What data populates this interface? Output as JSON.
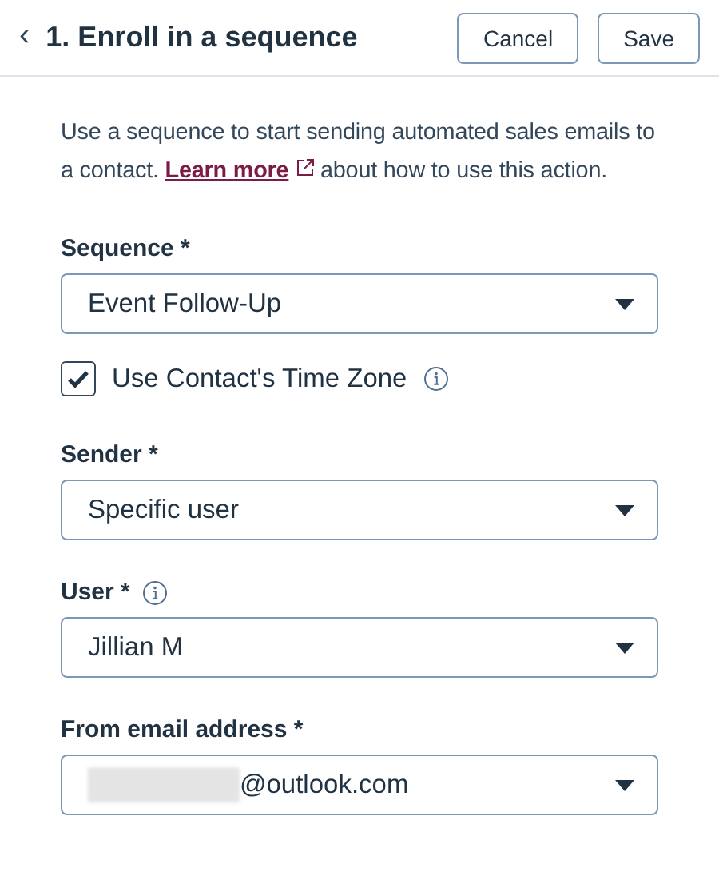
{
  "header": {
    "back_icon": "‹",
    "title": "1. Enroll in a sequence",
    "buttons": [
      "Cancel",
      "Save"
    ]
  },
  "description": {
    "before": "Use a sequence to start sending automated sales emails to a contact. ",
    "link": "Learn more",
    "after": " about how to use this action."
  },
  "fields": [
    {
      "kind": "select",
      "label": "Sequence *",
      "info": false,
      "value": "Event Follow-Up",
      "redacted_prefix": false
    },
    {
      "kind": "checkbox",
      "label": "Use Contact's Time Zone",
      "info": true,
      "checked": true
    },
    {
      "kind": "select",
      "label": "Sender *",
      "info": false,
      "value": "Specific user",
      "redacted_prefix": false
    },
    {
      "kind": "select",
      "label": "User *",
      "info": true,
      "value": "Jillian M",
      "redacted_prefix": false
    },
    {
      "kind": "select",
      "label": "From email address *",
      "info": false,
      "value": "@outlook.com",
      "redacted_prefix": true
    }
  ]
}
